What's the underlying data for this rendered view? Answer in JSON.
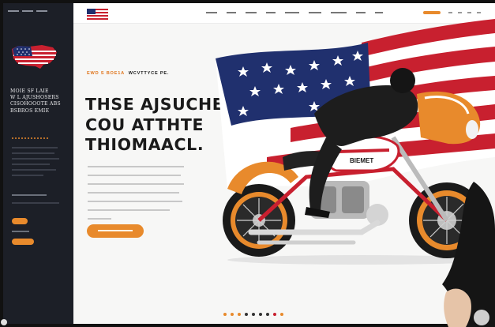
{
  "sidebar": {
    "title": "MOIE SF LAIE\nW L AJUSHOSERS\nCISOHOOOTE ABS\nBSBROS EMIE"
  },
  "hero": {
    "kicker_orange": "EWD S BOE1A",
    "kicker_dark": "WCVTTYCE PE.",
    "headline_line1": "THSE AJSUCHE",
    "headline_line2": "COU ATTHTE",
    "headline_line3": "THIOMAACL.",
    "bike_tank_text": "BIEMET"
  },
  "colors": {
    "accent": "#e88a2c",
    "sidebar_bg": "#1c1f27",
    "page_bg": "#f7f7f6",
    "headline": "#1a1a1a",
    "flag_red": "#c8202f",
    "flag_blue": "#20306e"
  },
  "pagination": {
    "dots": [
      "#e88a2c",
      "#e88a2c",
      "#e88a2c",
      "#333333",
      "#333333",
      "#333333",
      "#333333",
      "#c8202f",
      "#e88a2c"
    ]
  },
  "icons": {
    "sidebar_flag": "usa-map-flag-icon",
    "topbar_logo": "usa-flag-logo-icon"
  }
}
